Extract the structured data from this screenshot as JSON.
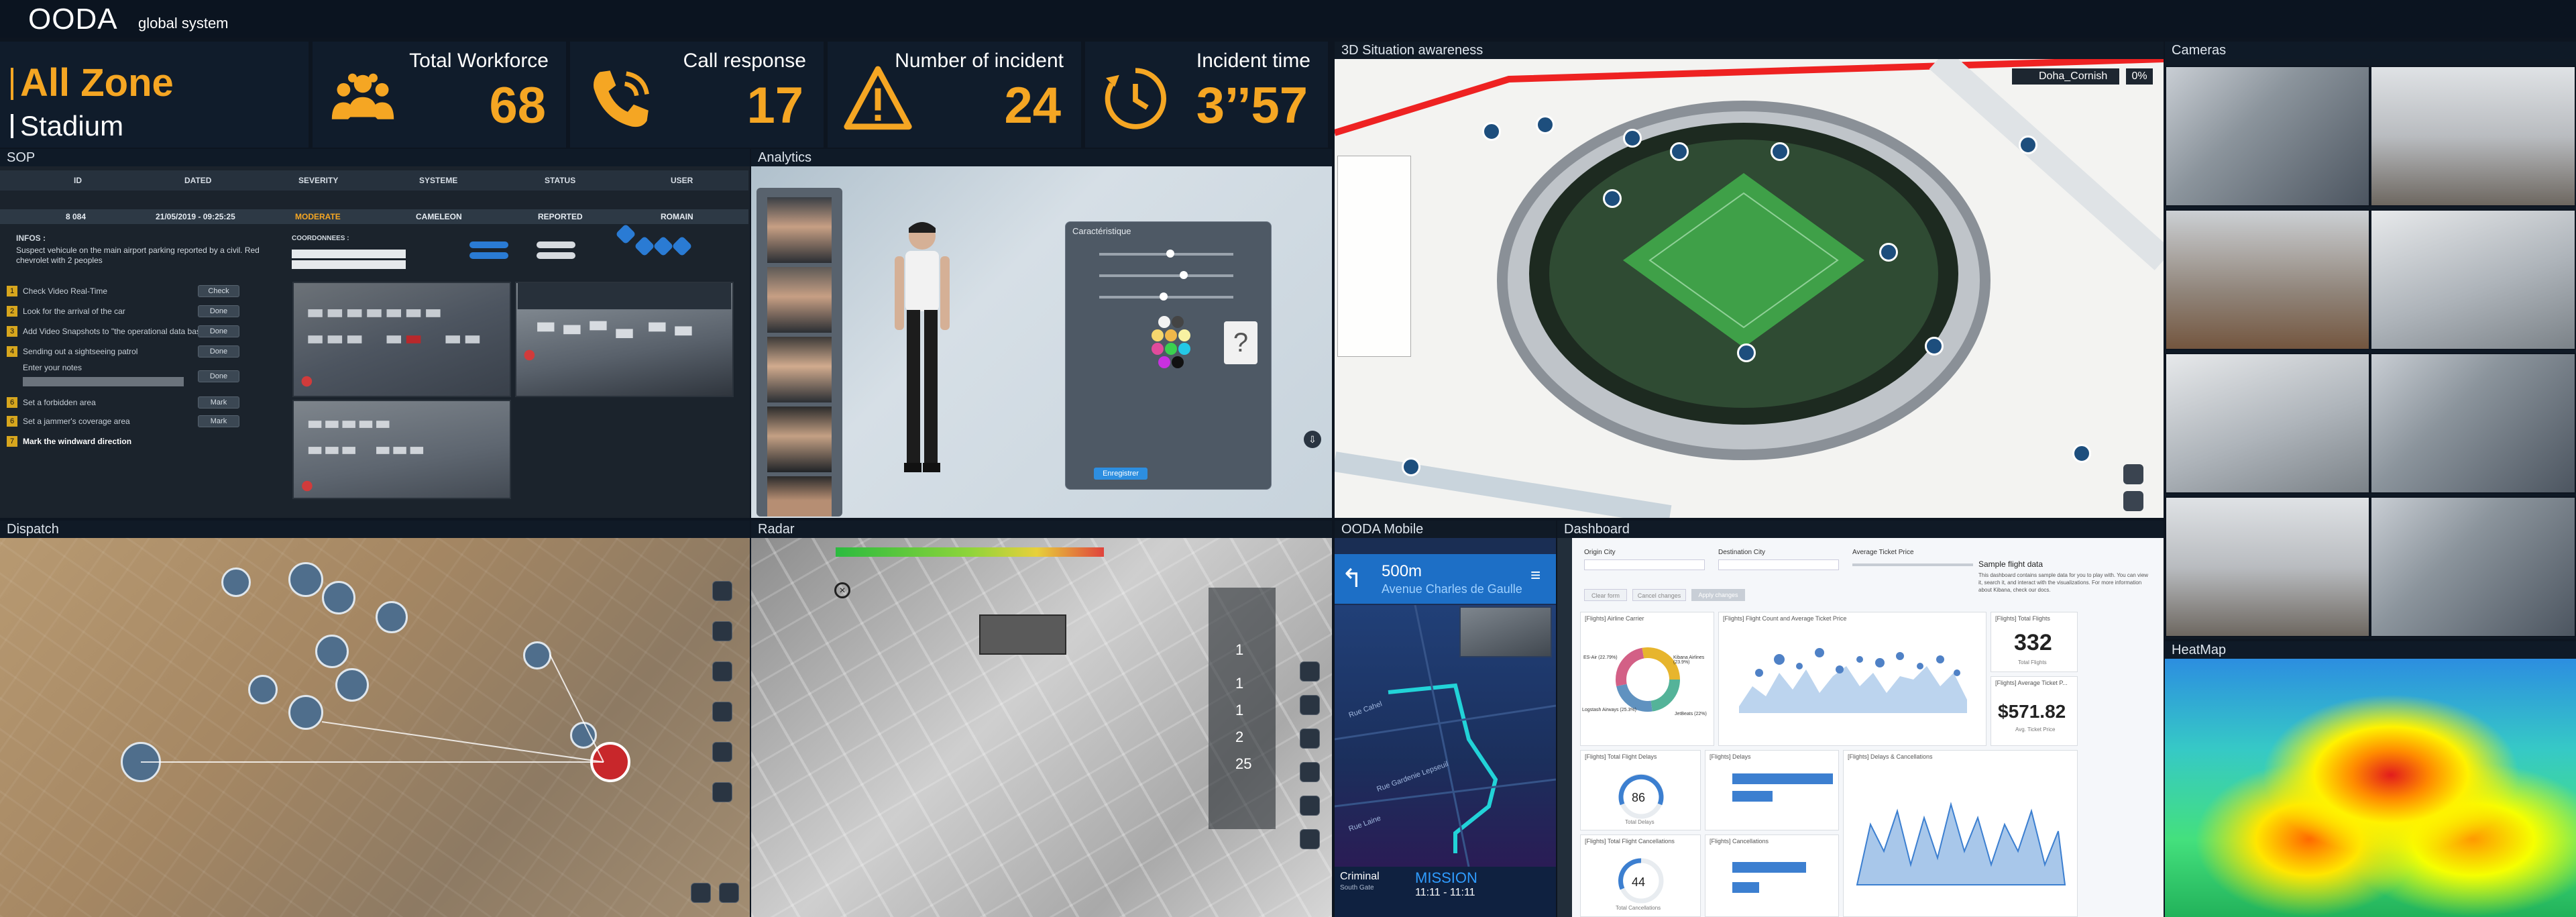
{
  "header": {
    "brand": "OODA",
    "subtitle": "global system"
  },
  "zone": {
    "title": "All Zone",
    "location": "Stadium"
  },
  "kpis": [
    {
      "label": "Total Workforce",
      "value": "68",
      "icon": "people-group-icon"
    },
    {
      "label": "Call response",
      "value": "17",
      "icon": "phone-call-icon"
    },
    {
      "label": "Number of incident",
      "value": "24",
      "icon": "warning-triangle-icon"
    },
    {
      "label": "Incident time",
      "value": "3’’57",
      "icon": "clock-timer-icon"
    }
  ],
  "panels": {
    "sop": "SOP",
    "analytics": "Analytics",
    "situation": "3D Situation awareness",
    "cameras": "Cameras",
    "dispatch": "Dispatch",
    "radar": "Radar",
    "mobile": "OODA  Mobile",
    "dashboard": "Dashboard",
    "heatmap": "HeatMap"
  },
  "sop": {
    "columns": [
      "ID",
      "DATED",
      "SEVERITY",
      "SYSTEME",
      "STATUS",
      "USER"
    ],
    "row": {
      "id": "8 084",
      "dated": "21/05/2019 - 09:25:25",
      "severity": "MODERATE",
      "system": "CAMELEON",
      "status": "REPORTED",
      "user": "ROMAIN"
    },
    "infos_label": "INFOS :",
    "infos_text": "Suspect vehicule on the main airport parking reported by a civil. Red chevrolet with 2 peoples",
    "coords_label": "COORDONNEES :",
    "steps": [
      {
        "n": "1",
        "text": "Check Video Real-Time",
        "btn": "Check"
      },
      {
        "n": "2",
        "text": "Look for the arrival of the car",
        "btn": "Done"
      },
      {
        "n": "3",
        "text": "Add Video Snapshots  to \"the operational data base\"",
        "btn": "Done"
      },
      {
        "n": "4",
        "text": "Sending out a sightseeing patrol",
        "btn": "Done"
      },
      {
        "n": "5",
        "text": "Enter your notes",
        "btn": "Done"
      },
      {
        "n": "6",
        "text": "Set a forbidden area",
        "btn": "Mark"
      },
      {
        "n": "6",
        "text": "Set a  jammer's coverage area",
        "btn": "Mark"
      },
      {
        "n": "7",
        "text": "Mark the windward direction",
        "btn": ""
      }
    ]
  },
  "analytics": {
    "panel_title": "Caractéristique",
    "save_label": "Enregistrer",
    "question": "?"
  },
  "situation": {
    "search_value": "Doha_Cornish",
    "percent": "0%"
  },
  "mobile": {
    "distance": "500m",
    "street": "Avenue Charles de Gaulle",
    "bottom_left_title": "Criminal",
    "bottom_left_sub": "South Gate",
    "mission_label": "MISSION",
    "mission_time": "11:11 - 11:11",
    "road1": "Rue Cahel",
    "road2": "Rue Gardenie Lepseuil",
    "road3": "Rue Laine"
  },
  "radar": {
    "counts": [
      "1",
      "1",
      "1",
      "2",
      "25"
    ]
  },
  "dashboard": {
    "filters": [
      "Origin City",
      "Destination City",
      "Average Ticket Price"
    ],
    "buttons": [
      "Clear form",
      "Cancel changes",
      "Apply changes"
    ],
    "sample_title": "Sample flight data",
    "sample_text": "This dashboard contains sample data for you to play with. You can view it, search it, and interact with the visualizations. For more information about Kibana, check our docs.",
    "airline_carrier": "[Flights] Airline Carrier",
    "flight_count_title": "[Flights] Flight Count and Average Ticket Price",
    "total_flights_title": "[Flights] Total Flights",
    "total_flights": "332",
    "total_flights_caption": "Total Flights",
    "avg_price_title": "[Flights] Average Ticket P...",
    "avg_price": "$571.82",
    "avg_price_caption": "Avg. Ticket Price",
    "total_delays_title": "[Flights] Total Flight Delays",
    "total_delays": "86",
    "total_delays_caption": "Total Delays",
    "delays_title": "[Flights] Delays",
    "delays_cancellations_title": "[Flights] Delays & Cancellations",
    "total_cancellations_title": "[Flights] Total Flight Cancellations",
    "total_cancellations": "44",
    "total_cancellations_caption": "Total Cancellations",
    "cancellations_title": "[Flights] Cancellations",
    "pie_labels": [
      "ES-Air (22.79%)",
      "Kibana Airlines (23.9%)",
      "Logstash Airways (25.3%)",
      "JetBeats (22%)"
    ],
    "pie_colors": [
      "#54b399",
      "#6092c0",
      "#d36086",
      "#e7b52d"
    ]
  },
  "colors": {
    "accent": "#f5a623",
    "panel_bg": "#101a26",
    "title_bg": "#0f1a27"
  }
}
